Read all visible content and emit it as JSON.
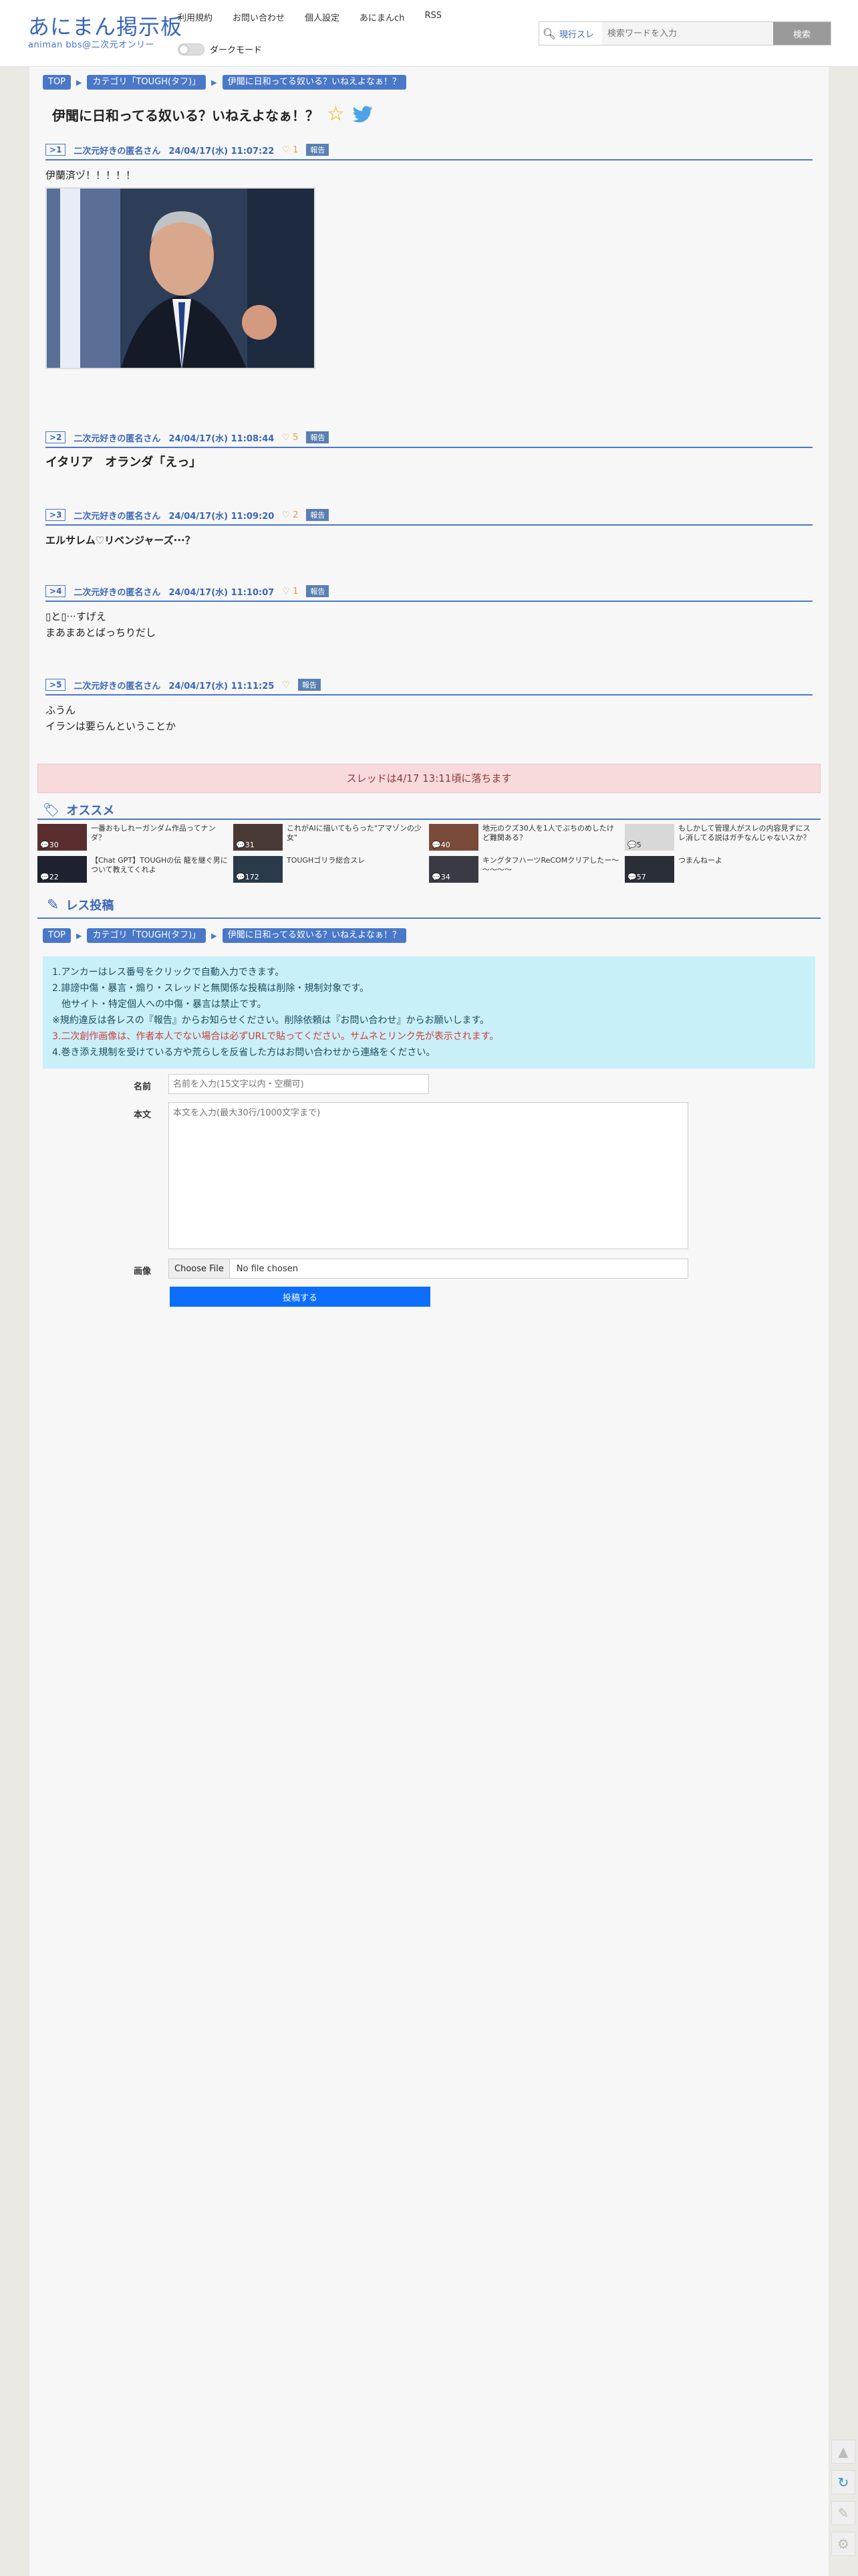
{
  "header": {
    "logo_main": "あにまん掲示板",
    "logo_sub": "animan bbs@二次元オンリー",
    "nav": [
      "利用規約",
      "お問い合わせ",
      "個人設定",
      "あにまんch",
      "RSS"
    ],
    "dark_mode_label": "ダークモード",
    "search_scope": "現行スレ",
    "search_placeholder": "検索ワードを入力",
    "search_button": "検索"
  },
  "breadcrumb": [
    "TOP",
    "カテゴリ「TOUGH(タフ)」",
    "伊聞に日和ってる奴いる？いねえよなぁ！？"
  ],
  "thread": {
    "title": "伊聞に日和ってる奴いる？いねえよなぁ！？"
  },
  "posts": [
    {
      "num": "1",
      "name": "二次元好きの匿名さん",
      "date": "24/04/17(水) 11:07:22",
      "likes": "1",
      "report": "報告",
      "lines": [
        "伊蘭済ヅ！！！！！"
      ]
    },
    {
      "num": "2",
      "name": "二次元好きの匿名さん",
      "date": "24/04/17(水) 11:08:44",
      "likes": "5",
      "report": "報告",
      "lines": [
        "イタリア　オランダ「えっ」"
      ]
    },
    {
      "num": "3",
      "name": "二次元好きの匿名さん",
      "date": "24/04/17(水) 11:09:20",
      "likes": "2",
      "report": "報告",
      "lines": [
        "エルサレム♡リベンジャーズ···？"
      ]
    },
    {
      "num": "4",
      "name": "二次元好きの匿名さん",
      "date": "24/04/17(水) 11:10:07",
      "likes": "1",
      "report": "報告",
      "lines": [
        "▯と▯···すげえ",
        "まあまあとばっちりだし"
      ]
    },
    {
      "num": "5",
      "name": "二次元好きの匿名さん",
      "date": "24/04/17(水) 11:11:25",
      "likes": "",
      "report": "報告",
      "lines": [
        "ふうん",
        "イランは要らんということか"
      ]
    }
  ],
  "fall_notice": "スレッドは4/17 13:11頃に落ちます",
  "recommend": {
    "heading": "オススメ",
    "items": [
      {
        "title": "一番おもしれーガンダム作品ってナンダ？",
        "count": "30"
      },
      {
        "title": "これがAIに描いてもらった\"アマゾンの少女\"",
        "count": "31"
      },
      {
        "title": "地元のクズ30人を1人でぶちのめしたけど難関ある？",
        "count": "40"
      },
      {
        "title": "もしかして管理人がスレの内容見ずにスレ消してる説はガチなんじゃないスか？",
        "count": "5"
      },
      {
        "title": "【Chat GPT】TOUGHの伝 龍を継ぐ男について教えてくれよ",
        "count": "22"
      },
      {
        "title": "TOUGHゴリラ総合スレ",
        "count": "172"
      },
      {
        "title": "キングタフハーツReCOMクリアしたー～～～～～",
        "count": "34"
      },
      {
        "title": "つまんねーよ",
        "count": "57"
      }
    ]
  },
  "reply": {
    "heading": "レス投稿",
    "rules": [
      "1.アンカーはレス番号をクリックで自動入力できます。",
      "2.誹謗中傷・暴言・煽り・スレッドと無関係な投稿は削除・規制対象です。",
      "　他サイト・特定個人への中傷・暴言は禁止です。",
      "※規約違反は各レスの『報告』からお知らせください。削除依頼は『お問い合わせ』からお願いします。",
      "3.二次創作画像は、作者本人でない場合は必ずURLで貼ってください。サムネとリンク先が表示されます。",
      "4.巻き添え規制を受けている方や荒らしを反省した方はお問い合わせから連絡をください。"
    ],
    "name_label": "名前",
    "name_placeholder": "名前を入力(15文字以内・空欄可)",
    "body_label": "本文",
    "body_placeholder": "本文を入力(最大30行/1000文字まで)",
    "image_label": "画像",
    "file_button": "Choose File",
    "file_status": "No file chosen",
    "submit": "投稿する"
  },
  "colors": {
    "accent": "#4a78c9",
    "notice_bg": "#f8d9dc",
    "rules_bg": "#c9eff8",
    "submit": "#0d6efd"
  },
  "tools": [
    "arrow-up-icon",
    "refresh-icon",
    "edit-icon",
    "gear-icon"
  ]
}
